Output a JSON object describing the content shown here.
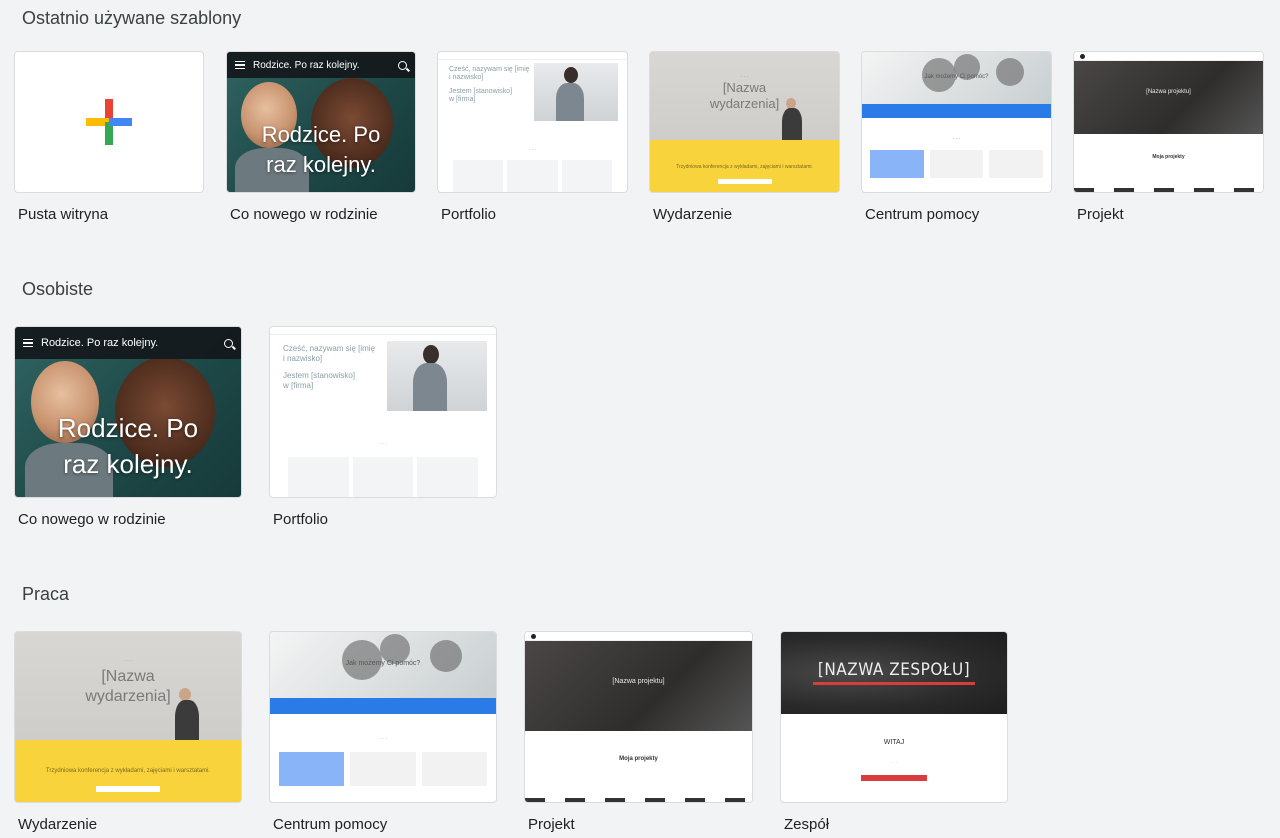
{
  "sections": [
    {
      "title": "Ostatnio używane szablony",
      "items": [
        "Pusta witryna",
        "Co nowego w rodzinie",
        "Portfolio",
        "Wydarzenie",
        "Centrum pomocy",
        "Projekt"
      ]
    },
    {
      "title": "Osobiste",
      "items": [
        "Co nowego w rodzinie",
        "Portfolio"
      ]
    },
    {
      "title": "Praca",
      "items": [
        "Wydarzenie",
        "Centrum pomocy",
        "Projekt",
        "Zespół"
      ]
    }
  ],
  "thumbs": {
    "family_bar": "Rodzice. Po raz kolejny.",
    "family_big_1": "Rodzice. Po",
    "family_big_2": "raz kolejny.",
    "portfolio_l1": "Cześć, nazywam się [imię",
    "portfolio_l2": "i nazwisko]",
    "portfolio_l3": "Jestem [stanowisko]",
    "portfolio_l4": "w [firma]",
    "event_title_1": "[Nazwa",
    "event_title_2": "wydarzenia]",
    "event_yellow": "Trzydniowa konferencja z wykładami, zajęciami i warsztatami.",
    "help_question": "Jak możemy Ci pomóc?",
    "project_title": "[Nazwa projektu]",
    "project_mine": "Moja projekty",
    "team_name": "[NAZWA ZESPOŁU]",
    "team_welcome": "WITAJ"
  },
  "colors": {
    "background": "#f1f3f4",
    "google_blue": "#4285f4",
    "google_red": "#ea4335",
    "google_yellow": "#fbbc04",
    "google_green": "#34a853",
    "event_yellow": "#f8d33c",
    "help_blue": "#2a7ae8",
    "team_red": "#d93c3c"
  }
}
